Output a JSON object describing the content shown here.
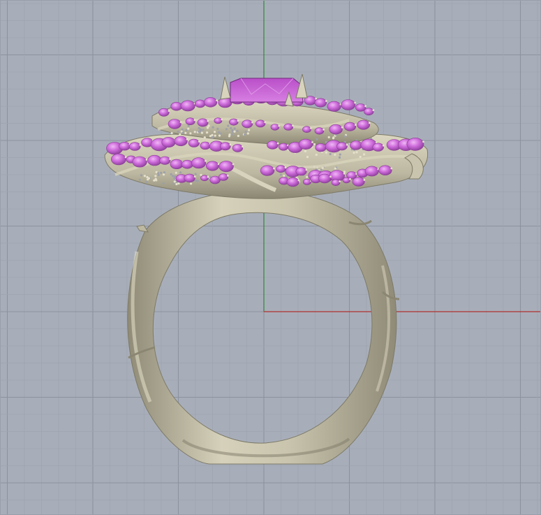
{
  "viewport": {
    "view_name": "",
    "background_color": "#a8aeb9",
    "minor_grid_color": "#9fa5b0",
    "major_grid_color": "#8d939e",
    "x_axis_color": "#b03030",
    "y_axis_color": "#2e8b3a"
  },
  "model": {
    "object": "ring",
    "metal_color": "#c9c4ad",
    "metal_shadow_color": "#8f8b77",
    "gem_color": "#c968d8",
    "gem_highlight_color": "#e7a6ef",
    "gem_shadow_color": "#8a3c98"
  }
}
